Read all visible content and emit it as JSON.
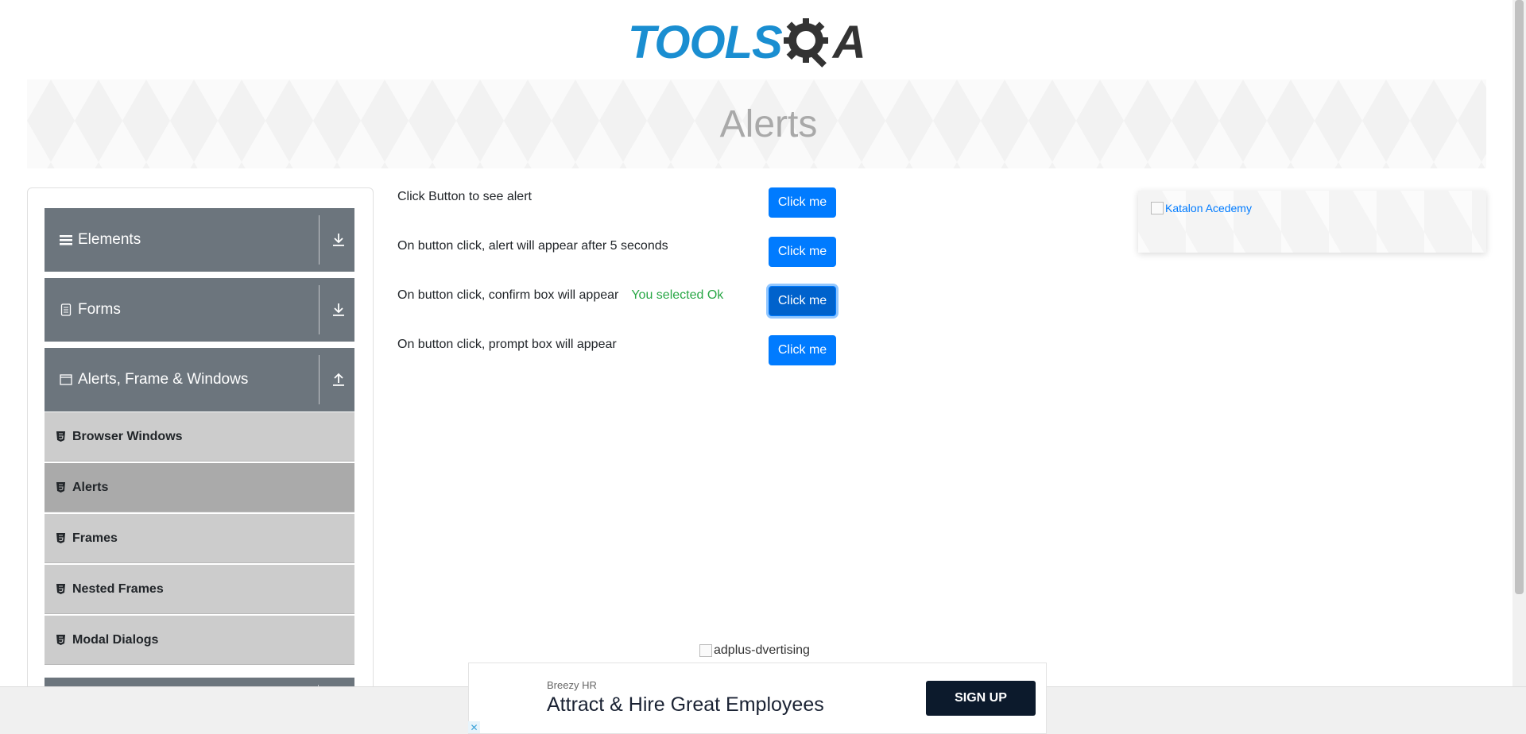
{
  "logo": {
    "part1": "TOOLS",
    "part2": "A"
  },
  "banner": {
    "title": "Alerts"
  },
  "sidebar": {
    "groups": [
      {
        "label": "Elements",
        "icon": "hamburger-icon",
        "toggle": "download-icon"
      },
      {
        "label": "Forms",
        "icon": "document-icon",
        "toggle": "download-icon"
      },
      {
        "label": "Alerts, Frame & Windows",
        "icon": "window-icon",
        "toggle": "upload-icon"
      }
    ],
    "items": [
      {
        "label": "Browser Windows",
        "active": false
      },
      {
        "label": "Alerts",
        "active": true
      },
      {
        "label": "Frames",
        "active": false
      },
      {
        "label": "Nested Frames",
        "active": false
      },
      {
        "label": "Modal Dialogs",
        "active": false
      }
    ]
  },
  "alerts": [
    {
      "text": "Click Button to see alert",
      "button": "Click me",
      "result": ""
    },
    {
      "text": "On button click, alert will appear after 5 seconds",
      "button": "Click me",
      "result": ""
    },
    {
      "text": "On button click, confirm box will appear",
      "button": "Click me",
      "result": "You selected Ok"
    },
    {
      "text": "On button click, prompt box will appear",
      "button": "Click me",
      "result": ""
    }
  ],
  "right_ad": {
    "alt": "Katalon Acedemy"
  },
  "adplus": {
    "alt": "adplus-dvertising"
  },
  "bottom_ad": {
    "brand": "Breezy HR",
    "headline": "Attract & Hire Great Employees",
    "cta": "SIGN UP",
    "close": "✕"
  },
  "colors": {
    "primary": "#007bff",
    "success": "#28a745",
    "sidebar_group": "#6c757d",
    "sidebar_item": "#cccccc",
    "sidebar_item_active": "#aaaaaa",
    "logo_blue": "#1a8ed1"
  }
}
